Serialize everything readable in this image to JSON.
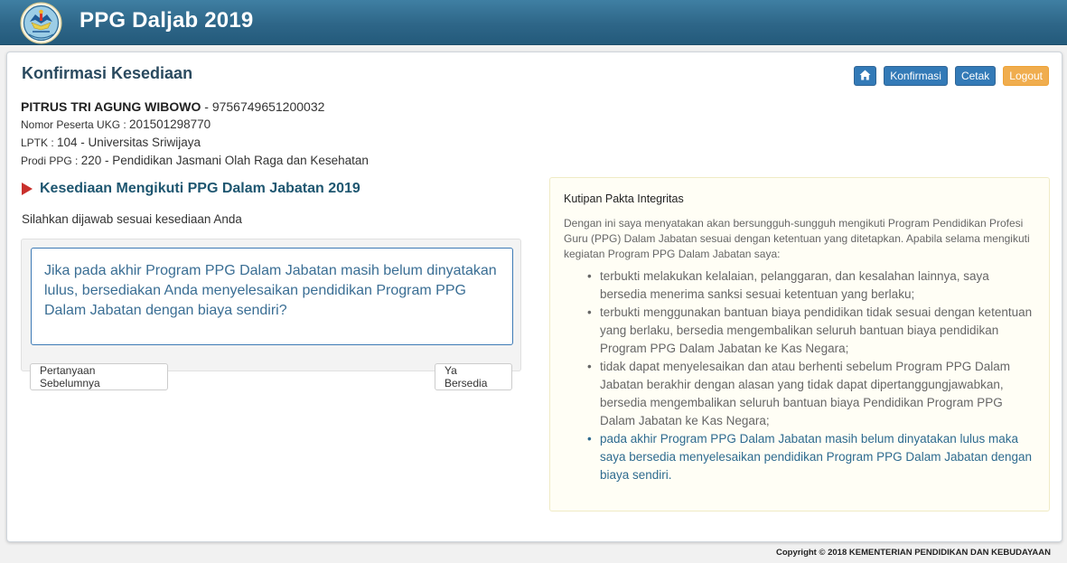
{
  "app": {
    "brand": "PPG Daljab 2019"
  },
  "page": {
    "title": "Konfirmasi Kesediaan"
  },
  "toolbar": {
    "home_icon": "home-icon",
    "konfirmasi_label": "Konfirmasi",
    "cetak_label": "Cetak",
    "logout_label": "Logout"
  },
  "participant": {
    "name": "PITRUS TRI AGUNG WIBOWO",
    "id_separator": " - ",
    "id": "9756749651200032",
    "ukg_label": "Nomor Peserta UKG : ",
    "ukg_value": "201501298770",
    "lptk_label": "LPTK : ",
    "lptk_value": "104 - Universitas Sriwijaya",
    "prodi_label": "Prodi PPG : ",
    "prodi_value": "220 - Pendidikan Jasmani Olah Raga dan Kesehatan"
  },
  "section": {
    "title": "Kesediaan Mengikuti PPG Dalam Jabatan 2019",
    "instruction": "Silahkan dijawab sesuai kesediaan Anda",
    "question": "Jika pada akhir Program PPG Dalam Jabatan masih belum dinyatakan lulus, bersediakan Anda menyelesaikan pendidikan Program PPG Dalam Jabatan dengan biaya sendiri?",
    "prev_button": "Pertanyaan Sebelumnya",
    "yes_button": "Ya Bersedia"
  },
  "pakta": {
    "title": "Kutipan Pakta Integritas",
    "intro": "Dengan ini saya menyatakan akan bersungguh-sungguh mengikuti Program Pendidikan Profesi Guru (PPG) Dalam Jabatan sesuai dengan ketentuan yang ditetapkan. Apabila selama mengikuti kegiatan Program PPG Dalam Jabatan saya:",
    "items": [
      "terbukti melakukan kelalaian, pelanggaran, dan kesalahan lainnya, saya bersedia menerima sanksi sesuai ketentuan yang berlaku;",
      "terbukti menggunakan bantuan biaya pendidikan tidak sesuai dengan ketentuan yang berlaku, bersedia mengembalikan seluruh bantuan biaya pendidikan Program PPG Dalam Jabatan ke Kas Negara;",
      "tidak dapat menyelesaikan dan atau berhenti sebelum Program PPG Dalam Jabatan berakhir dengan alasan yang tidak dapat dipertanggungjawabkan, bersedia mengembalikan seluruh bantuan biaya Pendidikan Program PPG Dalam Jabatan ke Kas Negara;",
      "pada akhir Program PPG Dalam Jabatan masih belum dinyatakan lulus maka saya bersedia menyelesaikan pendidikan Program PPG Dalam Jabatan dengan biaya sendiri."
    ]
  },
  "footer": {
    "copyright": "Copyright © 2018 KEMENTERIAN PENDIDIKAN DAN KEBUDAYAAN"
  },
  "colors": {
    "topbar": "#2e6688",
    "primary": "#337ab7",
    "warning": "#f0ad4e",
    "question_text": "#3a6e94",
    "highlight": "#2e6b8f",
    "arrow": "#c9302c"
  }
}
